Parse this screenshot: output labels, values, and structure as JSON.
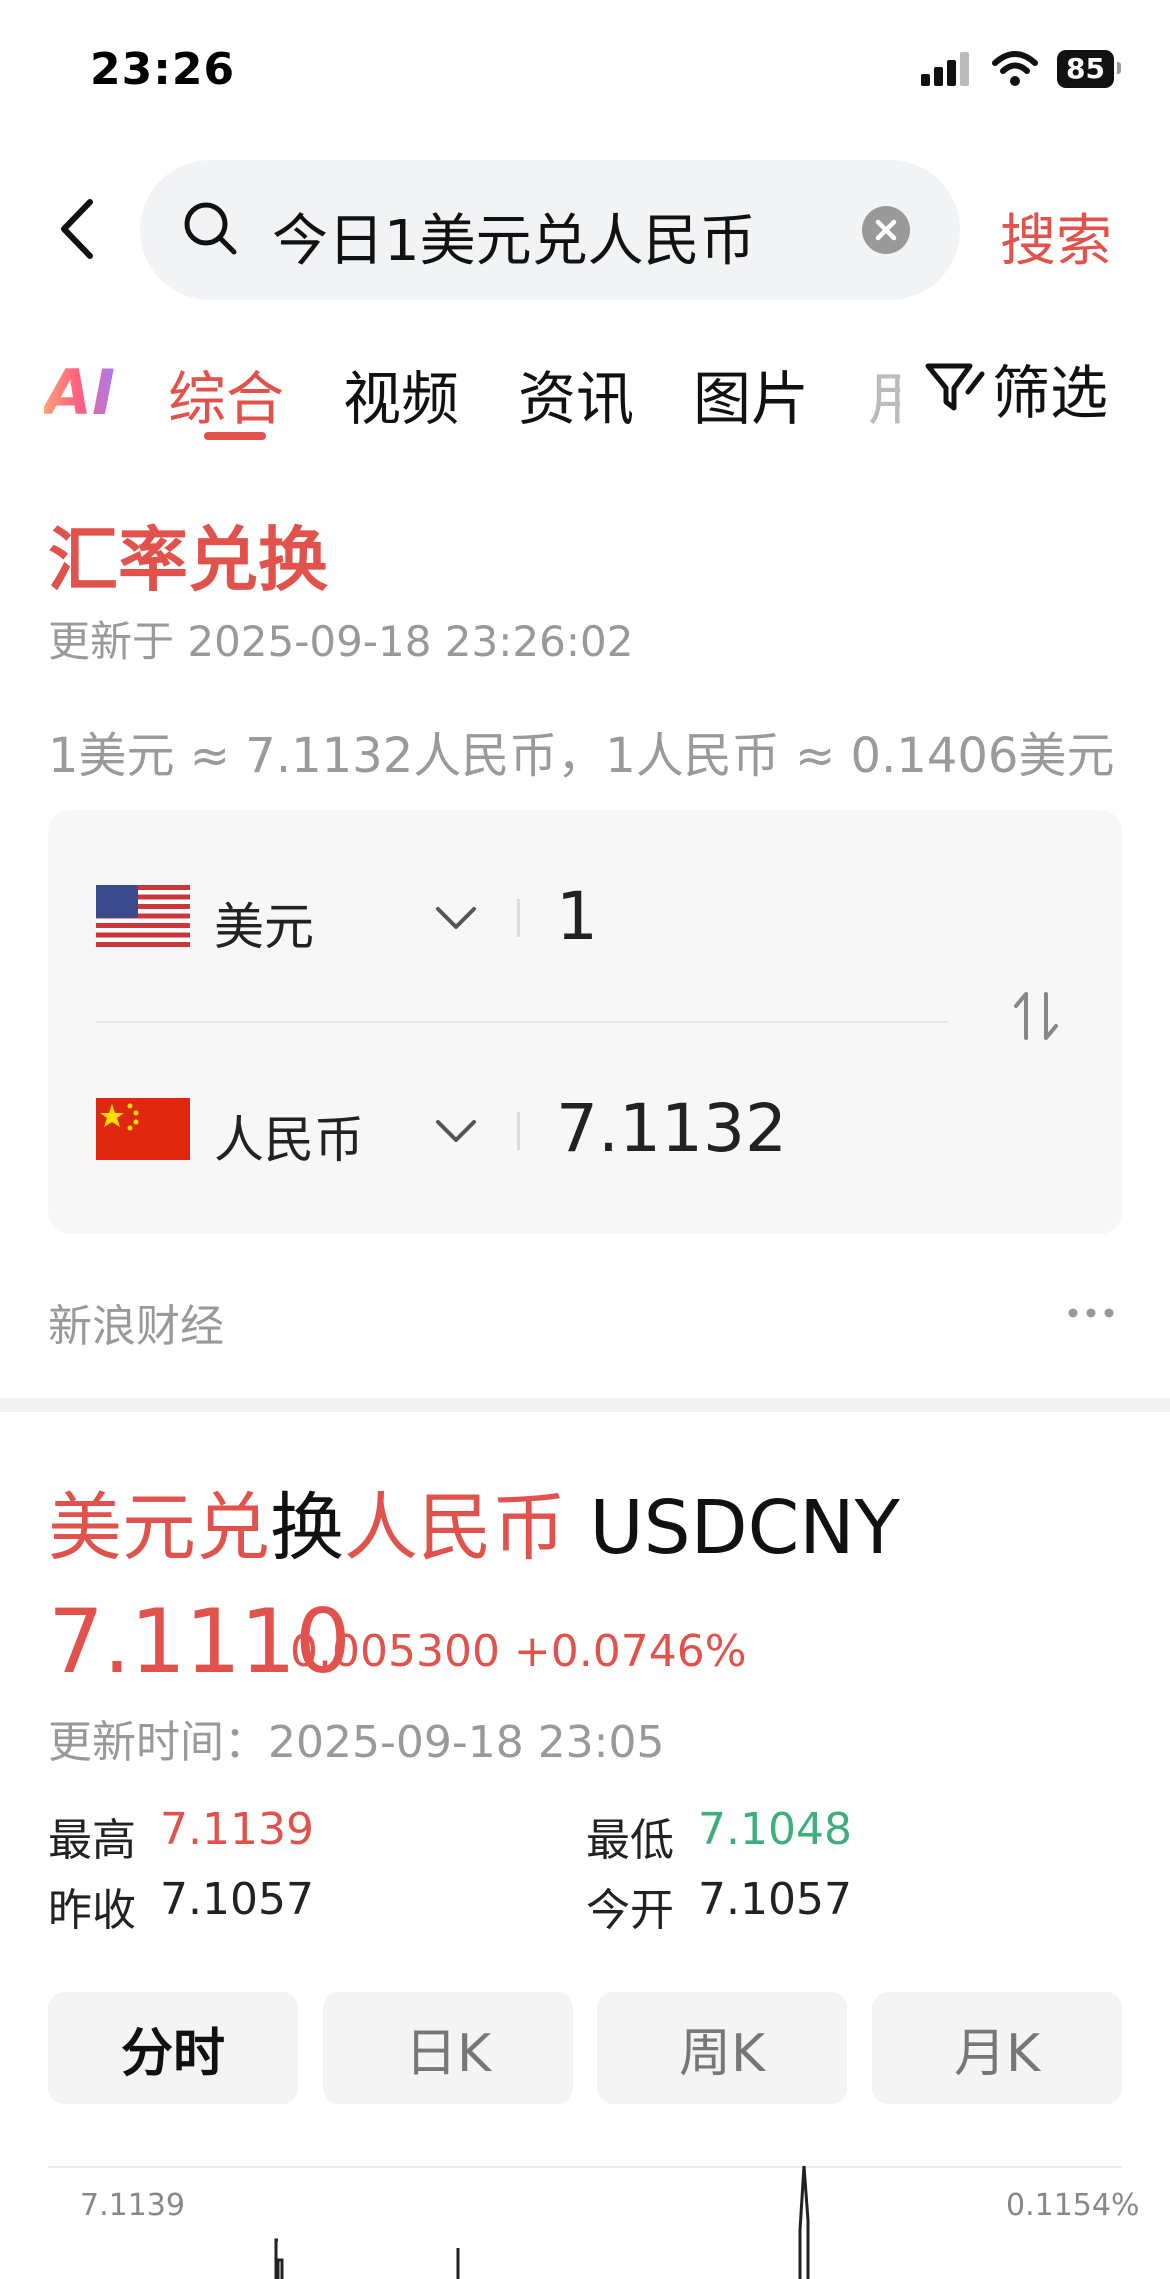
{
  "status_bar": {
    "time": "23:26",
    "battery": "85"
  },
  "search": {
    "query": "今日1美元兑人民币",
    "button": "搜索"
  },
  "tabs": {
    "ai": "AI",
    "items": [
      "综合",
      "视频",
      "资讯",
      "图片"
    ],
    "partial": "用",
    "filter": "筛选"
  },
  "exchange_card": {
    "title": "汇率兑换",
    "updated": "更新于 2025-09-18 23:26:02",
    "rate_line": "1美元 ≈ 7.1132人民币，1人民币 ≈ 0.1406美元",
    "from": {
      "currency": "美元",
      "amount": "1"
    },
    "to": {
      "currency": "人民币",
      "amount": "7.1132"
    },
    "source": "新浪财经"
  },
  "quote_card": {
    "title_parts": [
      {
        "text": "美元兑",
        "highlight": true
      },
      {
        "text": "换",
        "highlight": false
      },
      {
        "text": "人民币",
        "highlight": true
      },
      {
        "text": " USDCNY",
        "highlight": false
      }
    ],
    "price": "7.1110",
    "change": "0.005300 +0.0746%",
    "updated": "更新时间：2025-09-18 23:05",
    "stats": {
      "high_label": "最高",
      "high": "7.1139",
      "low_label": "最低",
      "low": "7.1048",
      "prev_close_label": "昨收",
      "prev_close": "7.1057",
      "open_label": "今开",
      "open": "7.1057"
    },
    "chart_tabs": [
      "分时",
      "日K",
      "周K",
      "月K"
    ],
    "chart_tab_active": 0,
    "chart_top_left_label": "7.1139",
    "chart_top_right_label": "0.1154%"
  },
  "colors": {
    "accent": "#e0524b",
    "down": "#3fae7d",
    "muted": "#999999"
  }
}
